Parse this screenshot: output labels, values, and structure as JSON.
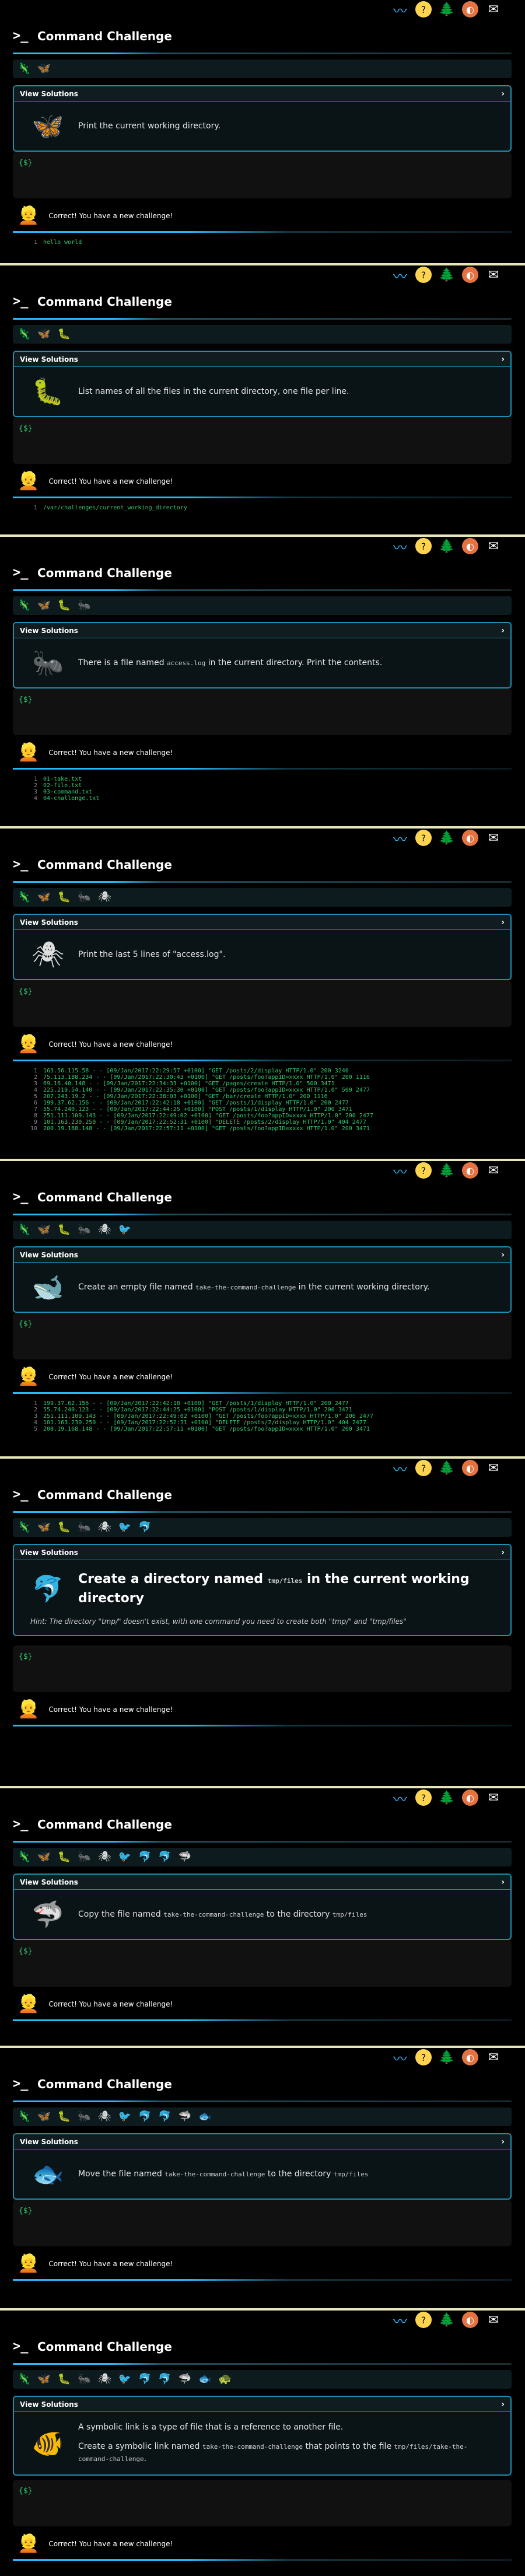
{
  "app": {
    "title": "Command Challenge",
    "view_solutions": "View Solutions",
    "prompt": "{$}",
    "success": "Correct! You have a new challenge!"
  },
  "top_icons": [
    "wave-icon",
    "help-icon",
    "tree-icon",
    "moon-icon",
    "mail-icon"
  ],
  "colors": {
    "accent": "#1e8fb0",
    "output": "#2ecc71",
    "separator": "#e6e6b8"
  },
  "panels": [
    {
      "badges": [
        "🦎",
        "🦋"
      ],
      "icon": "🦋",
      "task": "Print the current working directory.",
      "hint": "",
      "avatar": "👱",
      "output": [
        "hello world"
      ]
    },
    {
      "badges": [
        "🦎",
        "🦋",
        "🐛"
      ],
      "icon": "🐛",
      "task": "List names of all the files in the current directory, one file per line.",
      "hint": "",
      "avatar": "👱",
      "output": [
        "/var/challenges/current_working_directory"
      ]
    },
    {
      "badges": [
        "🦎",
        "🦋",
        "🐛",
        "🐜"
      ],
      "icon": "🐜",
      "task": "There is a file named access.log in the current directory. Print the contents.",
      "hint": "",
      "avatar": "👱",
      "output": [
        "01-take.txt",
        "02-file.txt",
        "03-command.txt",
        "04-challenge.txt"
      ]
    },
    {
      "badges": [
        "🦎",
        "🦋",
        "🐛",
        "🐜",
        "🕷"
      ],
      "icon": "🕷",
      "task": "Print the last 5 lines of \"access.log\".",
      "hint": "",
      "avatar": "👱",
      "output": [
        "163.56.115.58 - - [09/Jan/2017:22:29:57 +0100] \"GET /posts/2/display HTTP/1.0\" 200 3240",
        "75.113.188.234 - - [09/Jan/2017:22:30:43 +0100] \"GET /posts/foo?appID=xxxx HTTP/1.0\" 200 1116",
        "69.16.40.148 - - [09/Jan/2017:22:34:33 +0100] \"GET /pages/create HTTP/1.0\" 500 3471",
        "225.219.54.140 - - [09/Jan/2017:22:35:30 +0100] \"GET /posts/foo?appID=xxxx HTTP/1.0\" 500 2477",
        "207.243.19.2 - - [09/Jan/2017:22:38:03 +0100] \"GET /bar/create HTTP/1.0\" 200 1116",
        "199.37.62.156 - - [09/Jan/2017:22:42:18 +0100] \"GET /posts/1/display HTTP/1.0\" 200 2477",
        "55.74.240.123 - - [09/Jan/2017:22:44:25 +0100] \"POST /posts/1/display HTTP/1.0\" 200 3471",
        "251.111.109.143 - - [09/Jan/2017:22:49:02 +0100] \"GET /posts/foo?appID=xxxx HTTP/1.0\" 200 2477",
        "101.163.230.250 - - [09/Jan/2017:22:52:31 +0100] \"DELETE /posts/2/display HTTP/1.0\" 404 2477",
        "200.19.168.148 - - [09/Jan/2017:22:57:11 +0100] \"GET /posts/foo?appID=xxxx HTTP/1.0\" 200 3471"
      ]
    },
    {
      "badges": [
        "🦎",
        "🦋",
        "🐛",
        "🐜",
        "🕷",
        "🐦"
      ],
      "icon": "🐋",
      "task": "Create an empty file named take-the-command-challenge in the current working directory.",
      "hint": "",
      "avatar": "👱",
      "output": [
        "199.37.62.156 - - [09/Jan/2017:22:42:18 +0100] \"GET /posts/1/display HTTP/1.0\" 200 2477",
        "55.74.240.123 - - [09/Jan/2017:22:44:25 +0100] \"POST /posts/1/display HTTP/1.0\" 200 3471",
        "251.111.109.143 - - [09/Jan/2017:22:49:02 +0100] \"GET /posts/foo?appID=xxxx HTTP/1.0\" 200 2477",
        "101.163.230.250 - - [09/Jan/2017:22:52:31 +0100] \"DELETE /posts/2/display HTTP/1.0\" 404 2477",
        "200.19.168.148 - - [09/Jan/2017:22:57:11 +0100] \"GET /posts/foo?appID=xxxx HTTP/1.0\" 200 3471"
      ]
    },
    {
      "badges": [
        "🦎",
        "🦋",
        "🐛",
        "🐜",
        "🕷",
        "🐦",
        "🐬"
      ],
      "icon": "🐬",
      "task": "Create a directory named tmp/files in the current working directory",
      "hint": "Hint: The directory \"tmp/\" doesn't exist, with one command you need to create both \"tmp/\" and \"tmp/files\"",
      "avatar": "👱",
      "output": []
    },
    {
      "badges": [
        "🦎",
        "🦋",
        "🐛",
        "🐜",
        "🕷",
        "🐦",
        "🐬",
        "🐬",
        "🦈"
      ],
      "icon": "🦈",
      "task": "Copy the file named take-the-command-challenge to the directory tmp/files",
      "hint": "",
      "avatar": "👱",
      "output": []
    },
    {
      "badges": [
        "🦎",
        "🦋",
        "🐛",
        "🐜",
        "🕷",
        "🐦",
        "🐬",
        "🐬",
        "🦈",
        "🐟"
      ],
      "icon": "🐟",
      "task": "Move the file named take-the-command-challenge to the directory tmp/files",
      "hint": "",
      "avatar": "👱",
      "output": []
    },
    {
      "badges": [
        "🦎",
        "🦋",
        "🐛",
        "🐜",
        "🕷",
        "🐦",
        "🐬",
        "🐬",
        "🦈",
        "🐟",
        "🐢"
      ],
      "icon": "🐠",
      "task": "A symbolic link is a type of file that is a reference to another file.",
      "task2": "Create a symbolic link named take-the-command-challenge that points to the file tmp/files/take-the-command-challenge.",
      "hint": "",
      "avatar": "👱",
      "output": []
    }
  ]
}
